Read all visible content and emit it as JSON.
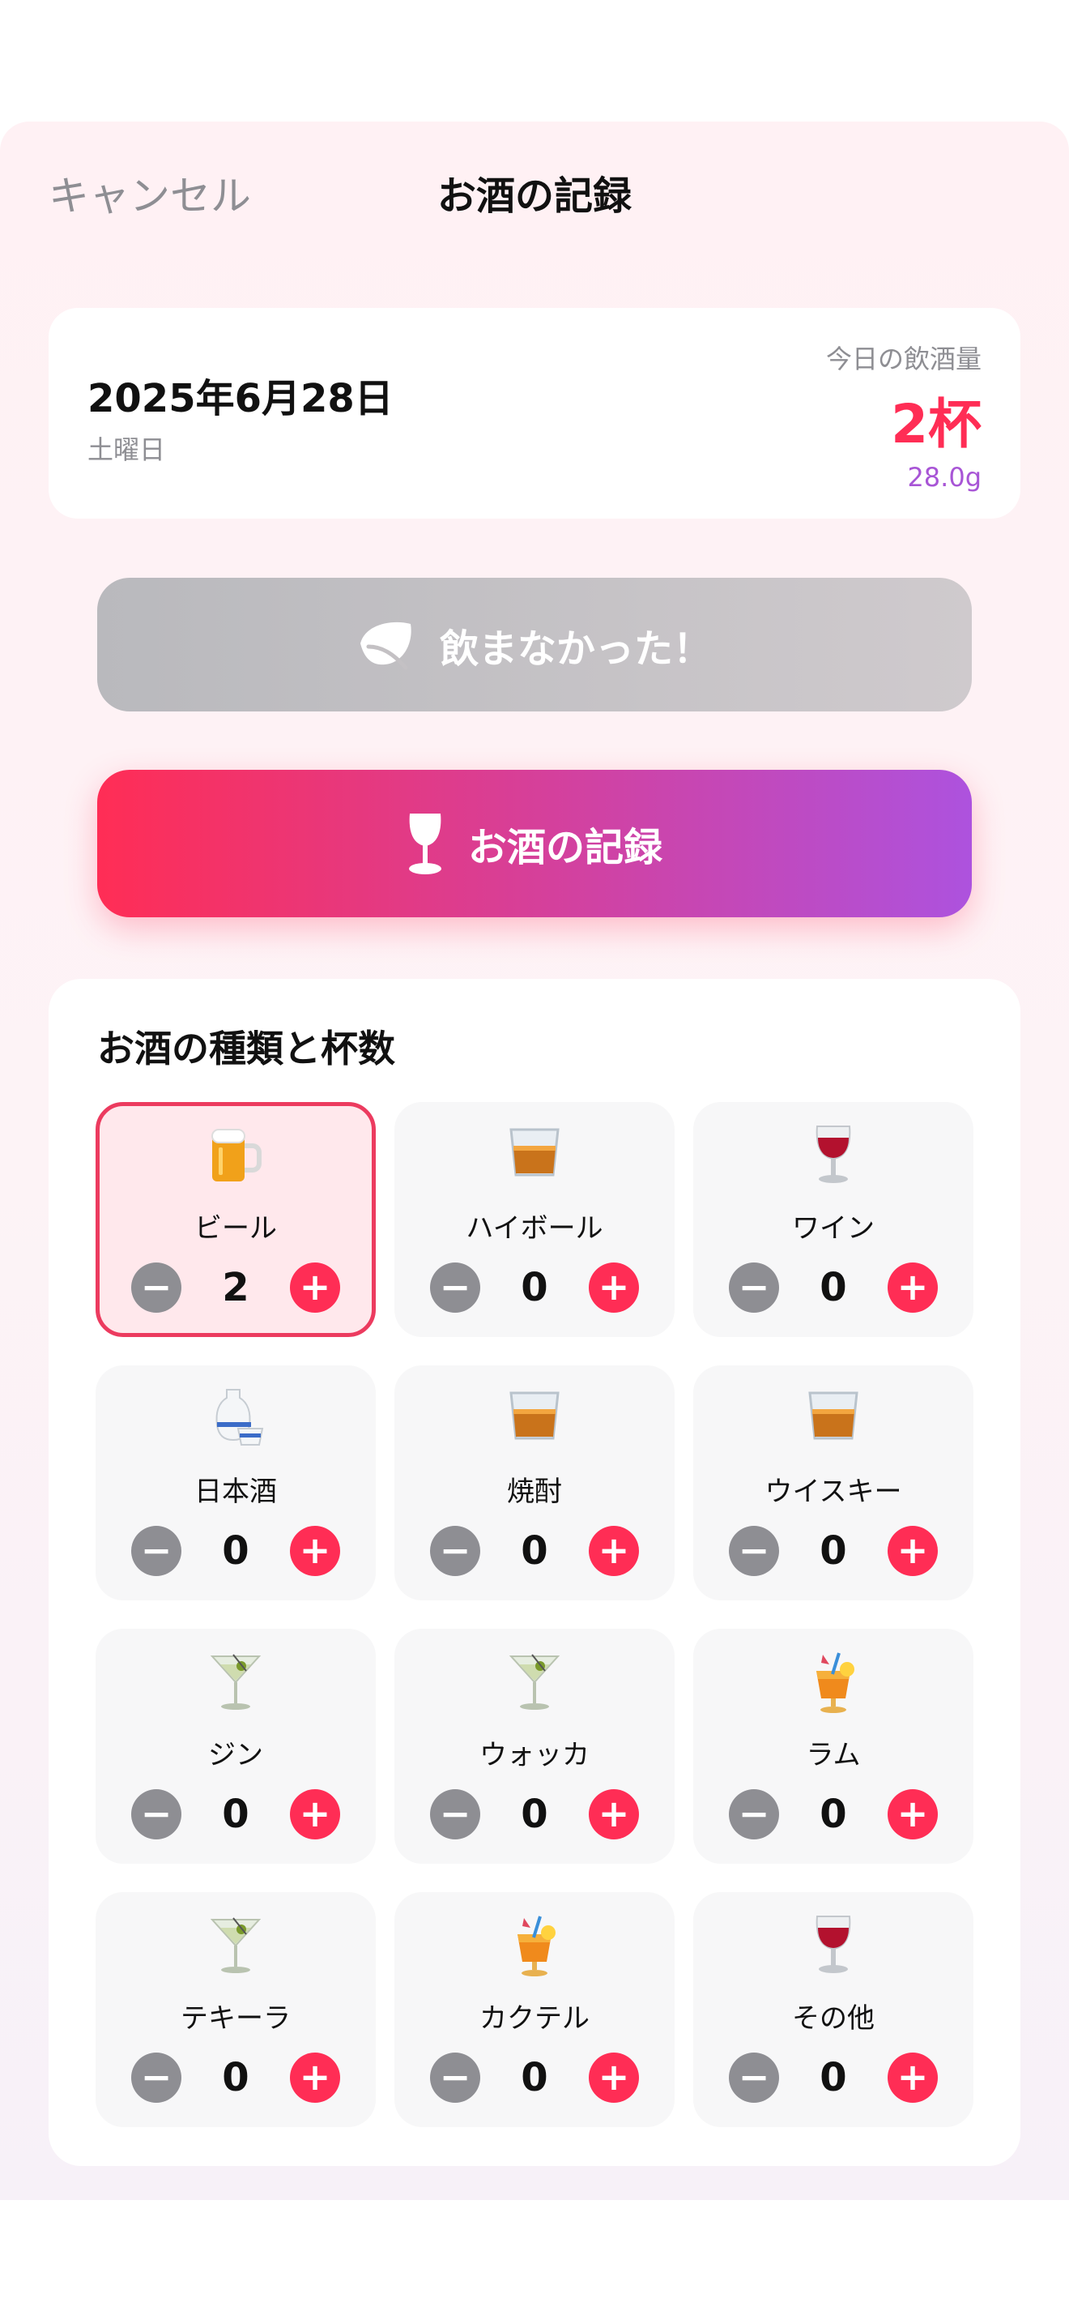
{
  "nav": {
    "cancel": "キャンセル",
    "title": "お酒の記録"
  },
  "date_card": {
    "date": "2025年6月28日",
    "weekday": "土曜日",
    "today_label": "今日の飲酒量",
    "today_count": "2杯",
    "today_grams": "28.0g"
  },
  "buttons": {
    "no_drink": "飲まなかった！",
    "record": "お酒の記録"
  },
  "types": {
    "title": "お酒の種類と杯数",
    "items": [
      {
        "name": "ビール",
        "count": "2",
        "icon": "beer-mug-icon",
        "selected": true
      },
      {
        "name": "ハイボール",
        "count": "0",
        "icon": "tumbler-glass-icon",
        "selected": false
      },
      {
        "name": "ワイン",
        "count": "0",
        "icon": "wine-glass-icon",
        "selected": false
      },
      {
        "name": "日本酒",
        "count": "0",
        "icon": "sake-icon",
        "selected": false
      },
      {
        "name": "焼酎",
        "count": "0",
        "icon": "tumbler-glass-icon",
        "selected": false
      },
      {
        "name": "ウイスキー",
        "count": "0",
        "icon": "tumbler-glass-icon",
        "selected": false
      },
      {
        "name": "ジン",
        "count": "0",
        "icon": "cocktail-glass-icon",
        "selected": false
      },
      {
        "name": "ウォッカ",
        "count": "0",
        "icon": "cocktail-glass-icon",
        "selected": false
      },
      {
        "name": "ラム",
        "count": "0",
        "icon": "tropical-drink-icon",
        "selected": false
      },
      {
        "name": "テキーラ",
        "count": "0",
        "icon": "cocktail-glass-icon",
        "selected": false
      },
      {
        "name": "カクテル",
        "count": "0",
        "icon": "tropical-drink-icon",
        "selected": false
      },
      {
        "name": "その他",
        "count": "0",
        "icon": "wine-glass-icon",
        "selected": false
      }
    ]
  },
  "colors": {
    "accent": "#ff2d55",
    "purple": "#ad52de",
    "grey": "#8e8e93"
  }
}
